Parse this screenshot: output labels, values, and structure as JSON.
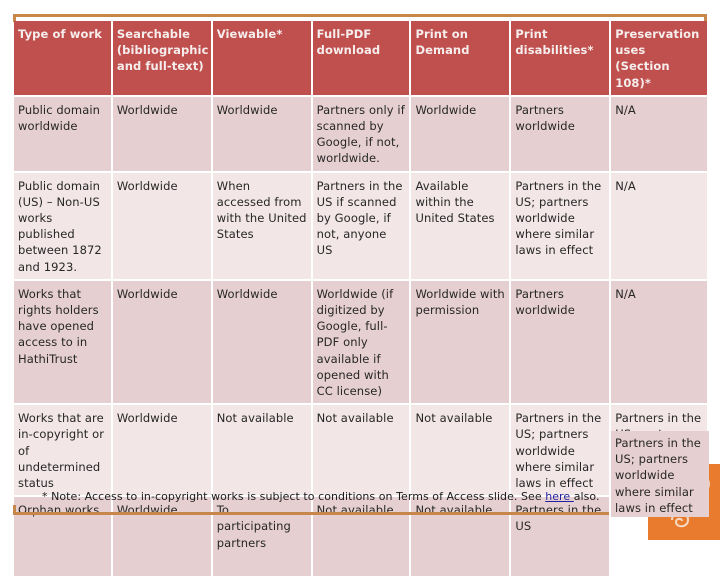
{
  "table": {
    "headers": [
      "Type of work",
      "Searchable (bibliographic and full-text)",
      "Viewable*",
      "Full-PDF download",
      "Print on Demand",
      "Print disabilities*",
      "Preservation uses (Section 108)*"
    ],
    "rows": [
      {
        "type": "Public domain worldwide",
        "searchable": "Worldwide",
        "viewable": "Worldwide",
        "pdf": "Partners only if scanned by Google, if not, worldwide.",
        "pod": "Worldwide",
        "disabilities": "Partners worldwide",
        "preservation": "N/A"
      },
      {
        "type": "Public domain (US) – Non-US works published between 1872 and 1923.",
        "searchable": "Worldwide",
        "viewable": "When accessed from with the United States",
        "pdf": "Partners in the US if scanned by Google, if not, anyone US",
        "pod": "Available within the United States",
        "disabilities": "Partners in the US; partners worldwide where similar laws in effect",
        "preservation": "N/A"
      },
      {
        "type": "Works that rights holders have opened access to in HathiTrust",
        "searchable": "Worldwide",
        "viewable": "Worldwide",
        "pdf": "Worldwide (if digitized by Google, full-PDF only available if opened with CC license)",
        "pod": "Worldwide with permission",
        "disabilities": "Partners worldwide",
        "preservation": "N/A"
      },
      {
        "type": "Works that are in-copyright or of undetermined status",
        "searchable": "Worldwide",
        "viewable": "Not available",
        "pdf": "Not available",
        "pod": "Not available",
        "disabilities": "Partners in the US; partners worldwide where similar laws in effect",
        "preservation": "Partners in the US; partner worldwide where similar laws in effect"
      },
      {
        "type": "Orphan works",
        "searchable": "Worldwide",
        "viewable": "To participating partners",
        "pdf": "Not available",
        "pod": "Not available",
        "disabilities": "Partners in the US",
        "preservation": "Partners in the US; partners worldwide where similar laws in effect"
      }
    ]
  },
  "note": {
    "prefix": "* Note: Access to in-copyright works is subject to conditions on Terms of Access slide. See ",
    "link_text": "here ",
    "suffix": "also."
  },
  "colors": {
    "header_bg": "#c0504d",
    "row_dark": "#e6cfd0",
    "row_light": "#f2e6e7",
    "rule": "#c8874a",
    "accent": "#e87b2e"
  }
}
